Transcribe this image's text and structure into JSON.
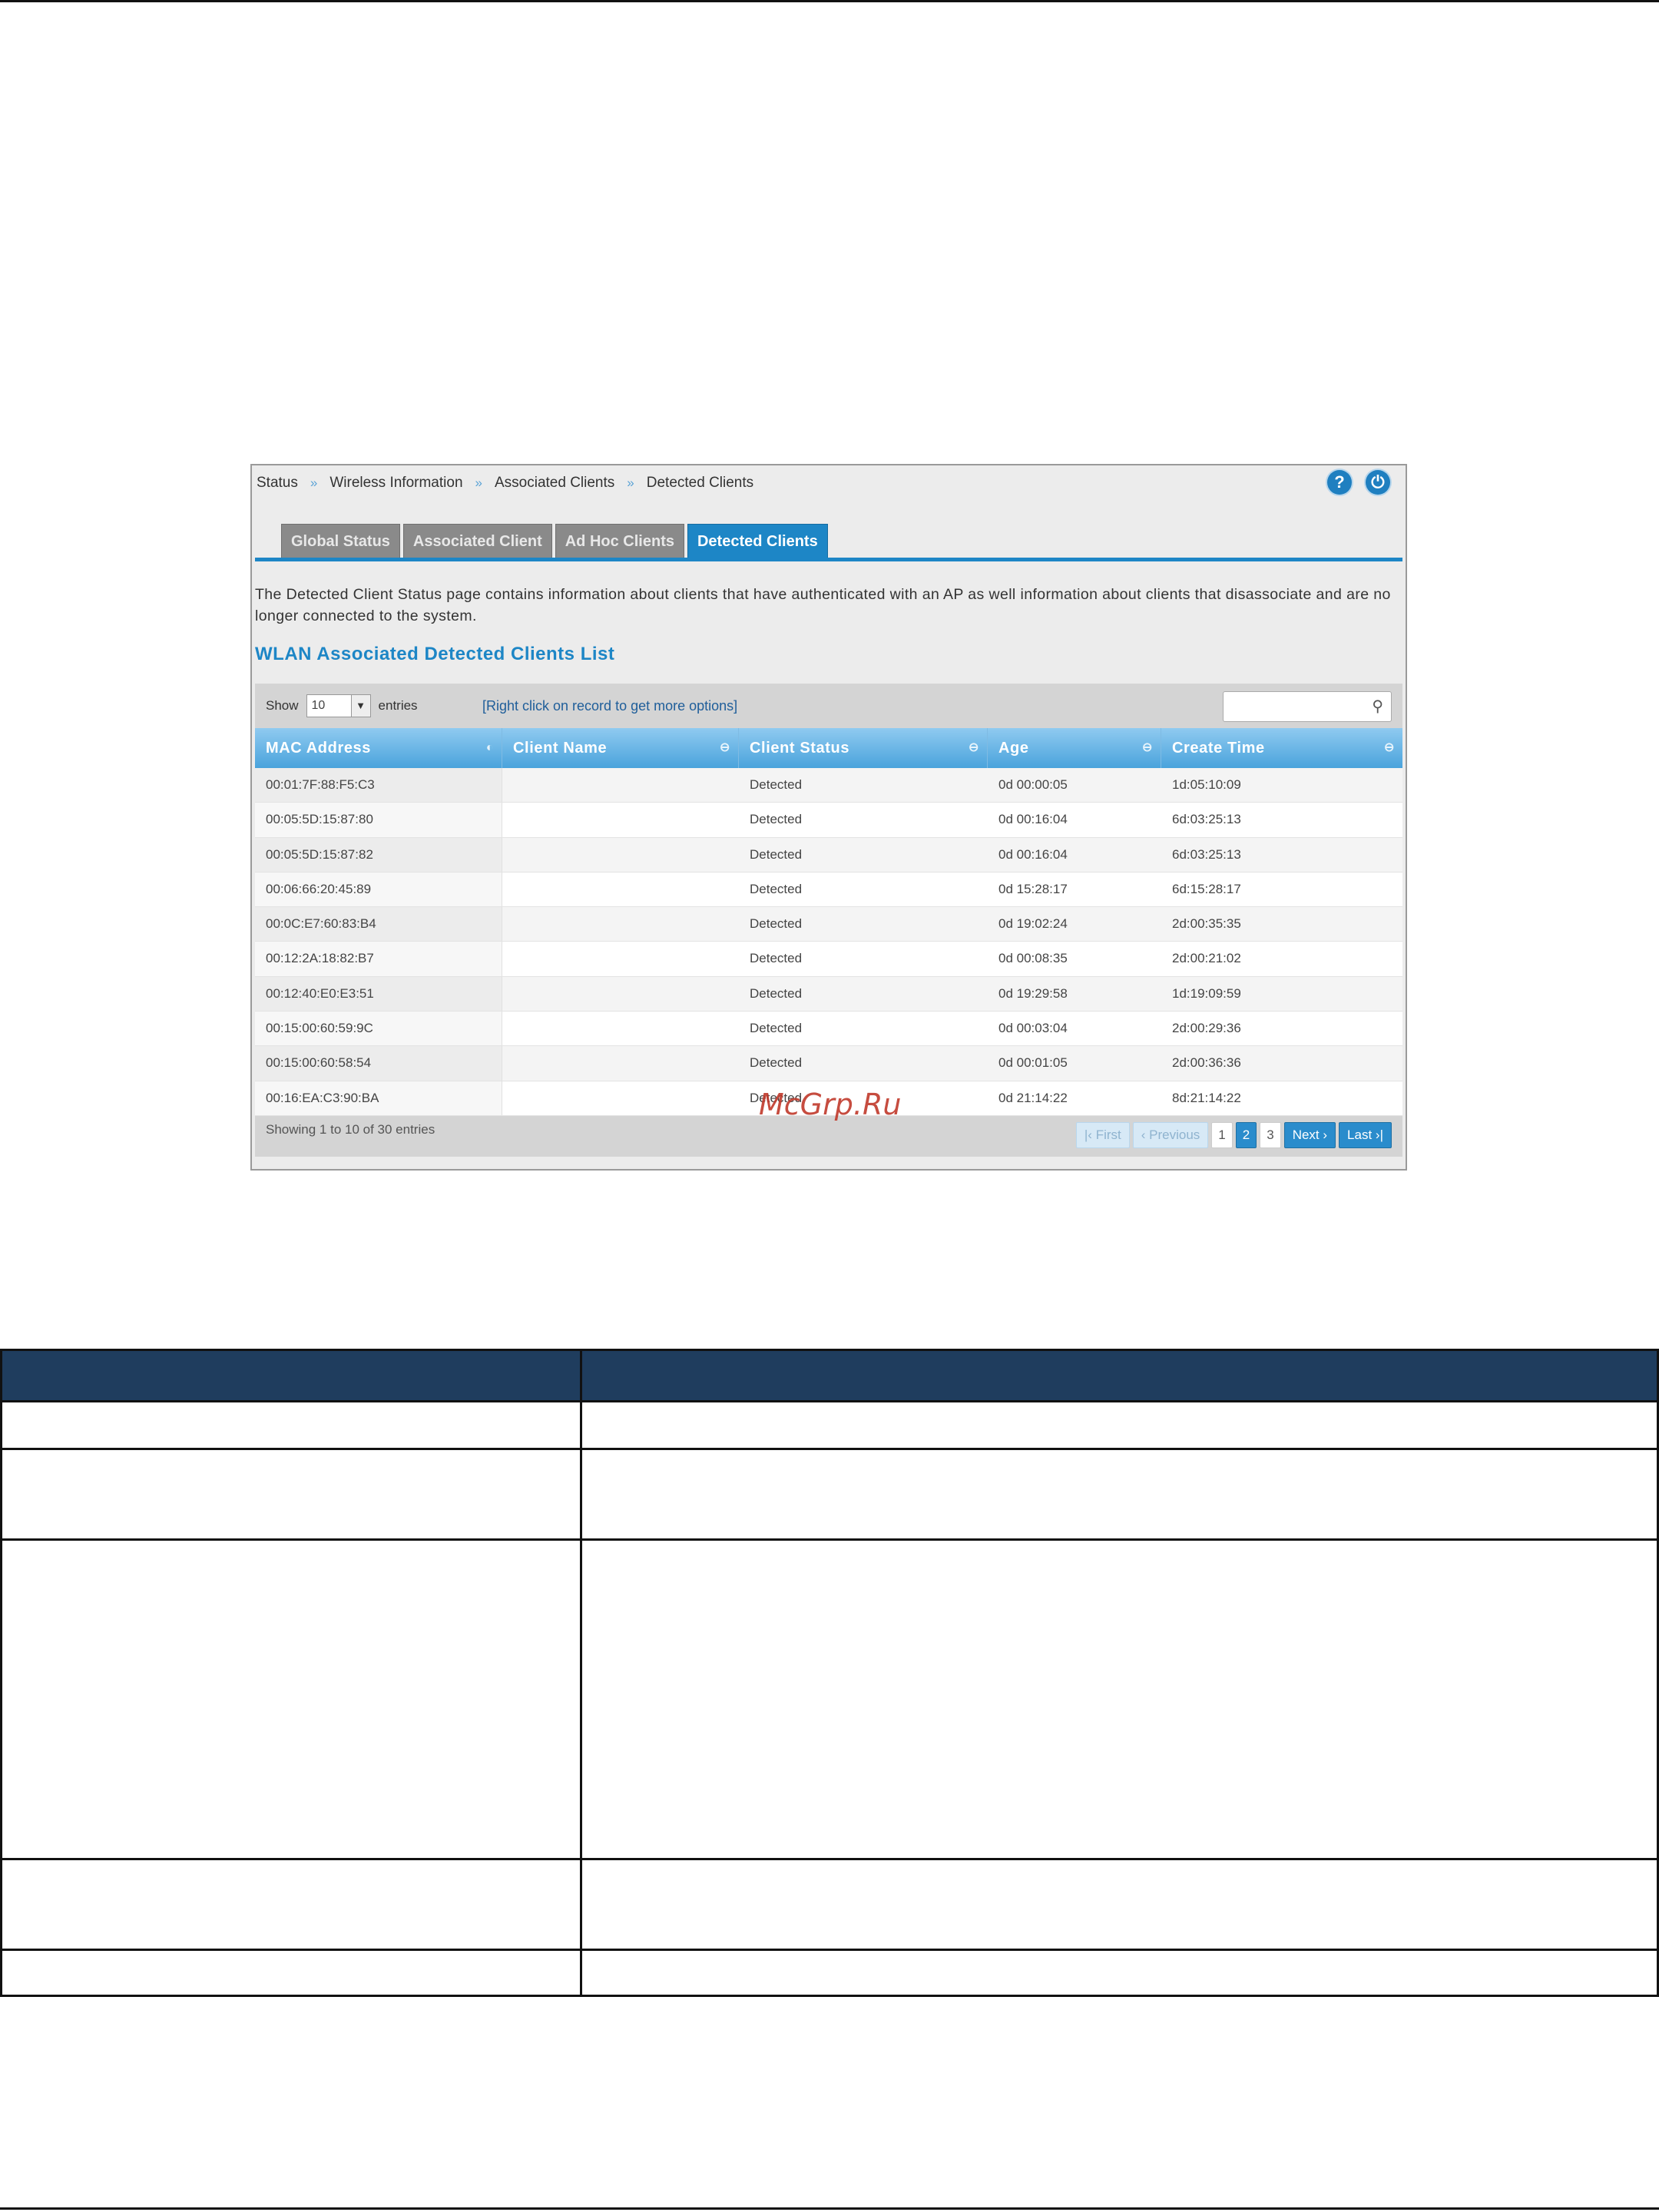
{
  "breadcrumb": [
    "Status",
    "Wireless Information",
    "Associated Clients",
    "Detected Clients"
  ],
  "breadcrumb_sep": "»",
  "icons": {
    "help": "help-icon",
    "logout": "logout-icon"
  },
  "tabs": [
    {
      "label": "Global Status",
      "active": false
    },
    {
      "label": "Associated Client",
      "active": false
    },
    {
      "label": "Ad Hoc Clients",
      "active": false
    },
    {
      "label": "Detected Clients",
      "active": true
    }
  ],
  "description": "The Detected Client Status page contains information about clients that have authenticated with an AP as well information about clients that disassociate and are no longer connected to the system.",
  "list_title": "WLAN Associated Detected Clients List",
  "toolbar": {
    "show_label": "Show",
    "entries_value": "10",
    "entries_label": "entries",
    "hint": "[Right click on record to get more options]"
  },
  "columns": [
    "MAC Address",
    "Client Name",
    "Client Status",
    "Age",
    "Create Time"
  ],
  "rows": [
    [
      "00:01:7F:88:F5:C3",
      "",
      "Detected",
      "0d 00:00:05",
      "1d:05:10:09"
    ],
    [
      "00:05:5D:15:87:80",
      "",
      "Detected",
      "0d 00:16:04",
      "6d:03:25:13"
    ],
    [
      "00:05:5D:15:87:82",
      "",
      "Detected",
      "0d 00:16:04",
      "6d:03:25:13"
    ],
    [
      "00:06:66:20:45:89",
      "",
      "Detected",
      "0d 15:28:17",
      "6d:15:28:17"
    ],
    [
      "00:0C:E7:60:83:B4",
      "",
      "Detected",
      "0d 19:02:24",
      "2d:00:35:35"
    ],
    [
      "00:12:2A:18:82:B7",
      "",
      "Detected",
      "0d 00:08:35",
      "2d:00:21:02"
    ],
    [
      "00:12:40:E0:E3:51",
      "",
      "Detected",
      "0d 19:29:58",
      "1d:19:09:59"
    ],
    [
      "00:15:00:60:59:9C",
      "",
      "Detected",
      "0d 00:03:04",
      "2d:00:29:36"
    ],
    [
      "00:15:00:60:58:54",
      "",
      "Detected",
      "0d 00:01:05",
      "2d:00:36:36"
    ],
    [
      "00:16:EA:C3:90:BA",
      "",
      "Detected",
      "0d 21:14:22",
      "8d:21:14:22"
    ]
  ],
  "footer": {
    "showing": "Showing 1 to 10 of 30 entries",
    "first": "First",
    "previous": "Previous",
    "pages": [
      "1",
      "2",
      "3"
    ],
    "active_page": "2",
    "next": "Next",
    "last": "Last"
  },
  "watermark": "McGrp.Ru",
  "colors": {
    "accent": "#1d86c6",
    "table_header": "#1f3d5e"
  }
}
